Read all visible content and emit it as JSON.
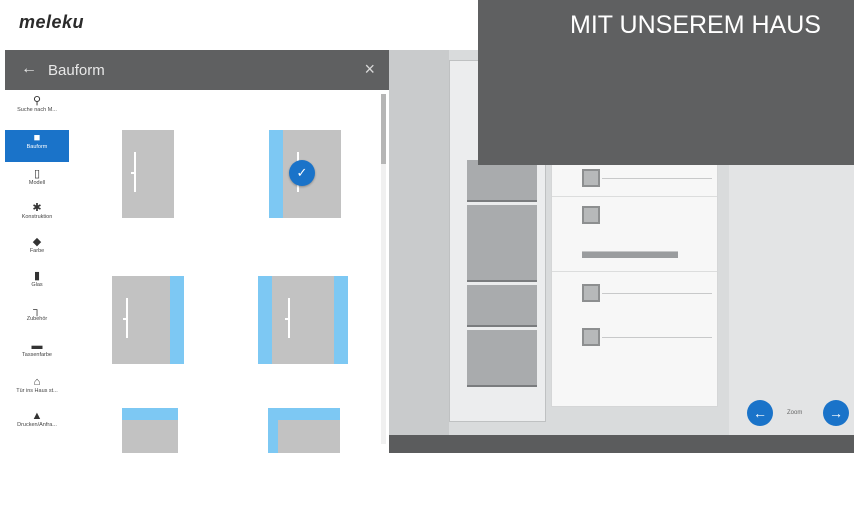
{
  "brand": {
    "logo": "meleku"
  },
  "panel": {
    "title": "Bauform",
    "back_icon": "arrow-left-icon",
    "close_icon": "close-icon"
  },
  "nav": [
    {
      "icon": "search-icon",
      "glyph": "⚲",
      "label": "Suche nach M..."
    },
    {
      "icon": "door-icon",
      "glyph": "■",
      "label": "Bauform",
      "active": true
    },
    {
      "icon": "model-icon",
      "glyph": "▯",
      "label": "Modell"
    },
    {
      "icon": "gear-icon",
      "glyph": "✱",
      "label": "Konstruktion"
    },
    {
      "icon": "paint-icon",
      "glyph": "◆",
      "label": "Farbe"
    },
    {
      "icon": "glass-icon",
      "glyph": "▮",
      "label": "Glas"
    },
    {
      "icon": "handle-icon",
      "glyph": "┐",
      "label": "Zubehör"
    },
    {
      "icon": "mailbox-icon",
      "glyph": "▬",
      "label": "Tassenfarbe"
    },
    {
      "icon": "house-icon",
      "glyph": "⌂",
      "label": "Tür ins Haus st..."
    },
    {
      "icon": "print-icon",
      "glyph": "▲",
      "label": "Drucken/Anfra..."
    }
  ],
  "tiles": [
    {
      "variant": "door-only",
      "selected": false
    },
    {
      "variant": "door-sidepanel-left",
      "selected": true
    },
    {
      "variant": "door-sidepanel-right",
      "selected": false
    },
    {
      "variant": "door-two-sidepanels",
      "selected": false
    },
    {
      "variant": "door-toplight",
      "selected": false
    },
    {
      "variant": "door-toplight-sidepanel",
      "selected": false
    }
  ],
  "check_icon": "✓",
  "pager": {
    "prev_icon": "←",
    "next_icon": "→",
    "label": "Zoom"
  },
  "banner": {
    "text": "MIT UNSEREM HAUS"
  }
}
